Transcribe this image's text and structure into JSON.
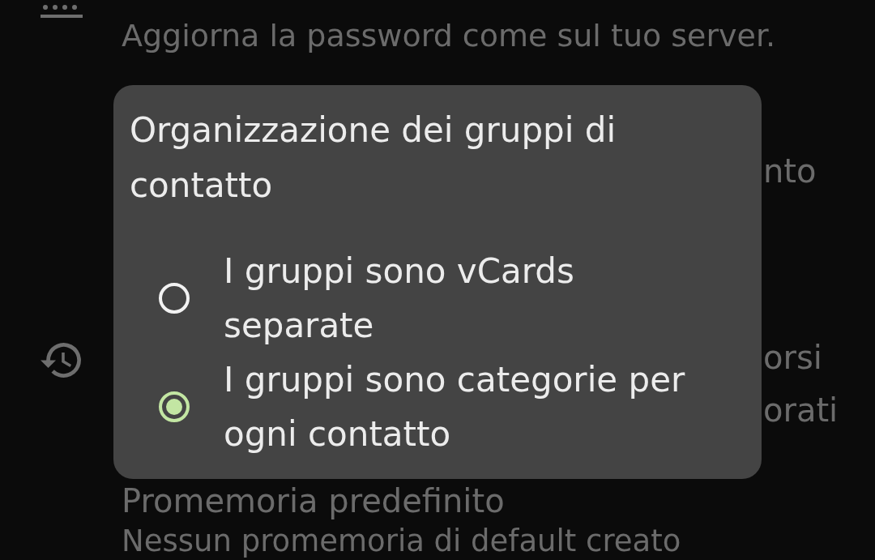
{
  "settings": [
    {
      "kind": "password",
      "subtitle": "Aggiorna la password come sul tuo server."
    },
    {
      "kind": "fragment",
      "lines": [
        "nto"
      ]
    },
    {
      "kind": "history",
      "lines": [
        "orsi",
        "orati"
      ]
    },
    {
      "kind": "plain",
      "title": "Promemoria predefinito",
      "subtitle": "Nessun promemoria di default creato"
    }
  ],
  "dialog": {
    "title": "Organizzazione dei gruppi di contatto",
    "options": [
      {
        "label": "I gruppi sono vCards separate",
        "selected": false
      },
      {
        "label": "I gruppi sono categorie per ogni contatto",
        "selected": true
      }
    ]
  }
}
